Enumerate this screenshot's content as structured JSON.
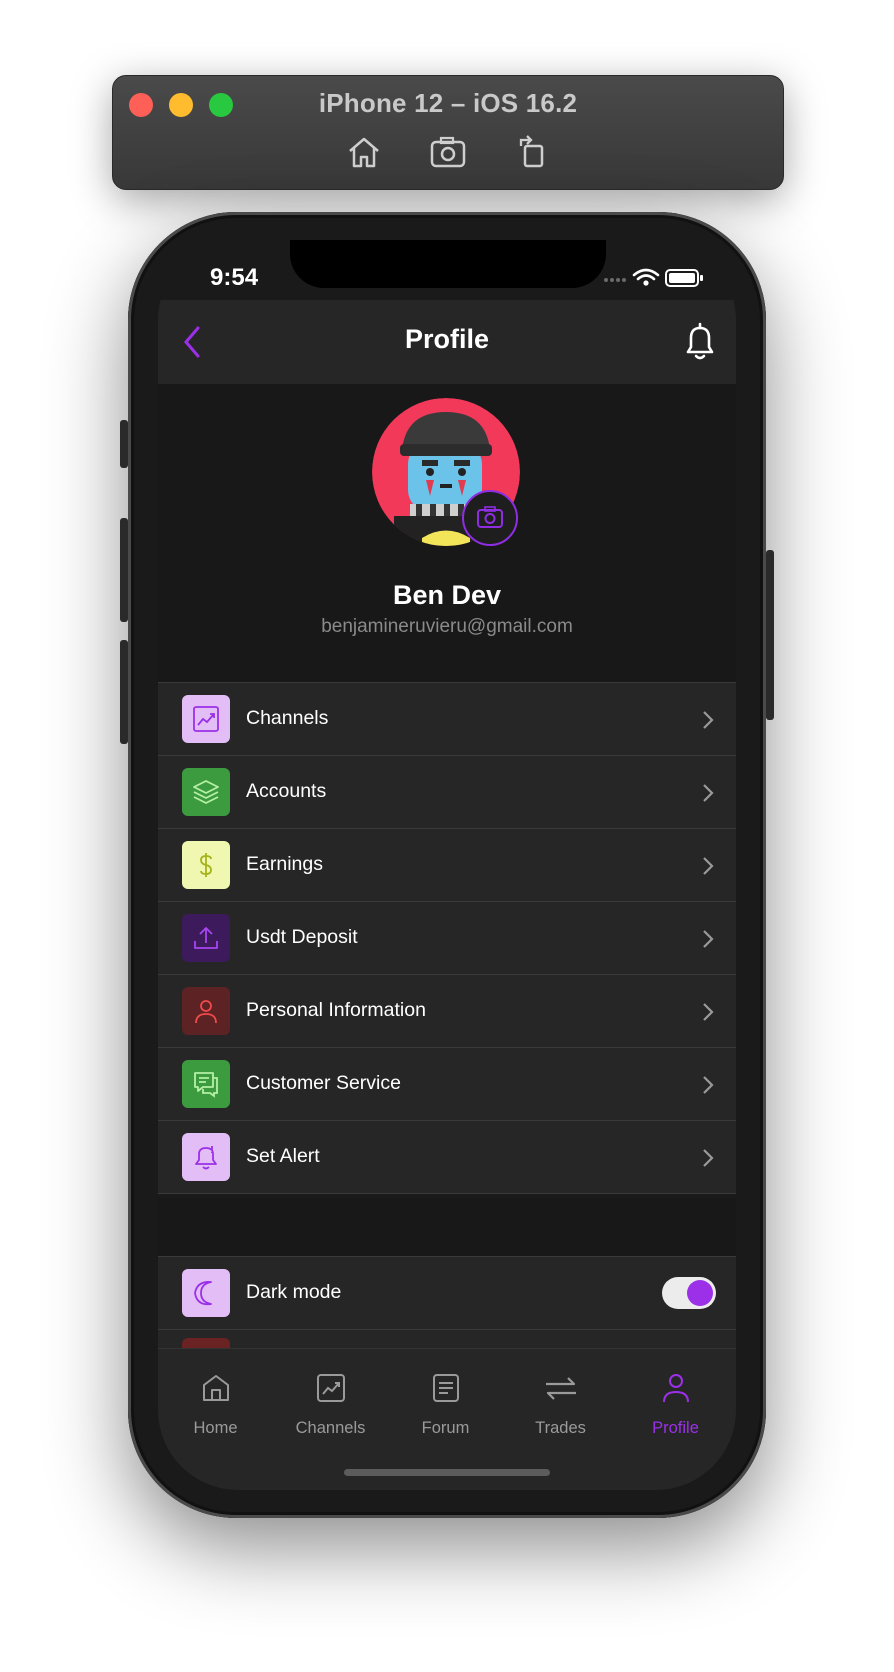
{
  "simulator": {
    "title": "iPhone 12 – iOS 16.2",
    "tools": [
      "home-icon",
      "screenshot-icon",
      "rotate-icon"
    ]
  },
  "status_bar": {
    "time": "9:54"
  },
  "header": {
    "title": "Profile"
  },
  "profile": {
    "name": "Ben Dev",
    "email": "benjamineruvieru@gmail.com"
  },
  "menu": {
    "items": [
      {
        "label": "Channels",
        "icon": "chart-icon"
      },
      {
        "label": "Accounts",
        "icon": "layers-icon"
      },
      {
        "label": "Earnings",
        "icon": "dollar-icon"
      },
      {
        "label": "Usdt Deposit",
        "icon": "upload-icon"
      },
      {
        "label": "Personal Information",
        "icon": "user-icon"
      },
      {
        "label": "Customer Service",
        "icon": "chat-icon"
      },
      {
        "label": "Set Alert",
        "icon": "bell-alert-icon"
      }
    ]
  },
  "settings": {
    "dark_mode_label": "Dark mode",
    "dark_mode_on": true
  },
  "tabbar": {
    "tabs": [
      {
        "label": "Home",
        "icon": "home-icon"
      },
      {
        "label": "Channels",
        "icon": "chart-icon"
      },
      {
        "label": "Forum",
        "icon": "document-icon"
      },
      {
        "label": "Trades",
        "icon": "arrows-icon"
      },
      {
        "label": "Profile",
        "icon": "user-icon"
      }
    ],
    "active": "Profile"
  },
  "colors": {
    "accent": "#9b30e8",
    "background": "#181818",
    "row": "#262626"
  }
}
